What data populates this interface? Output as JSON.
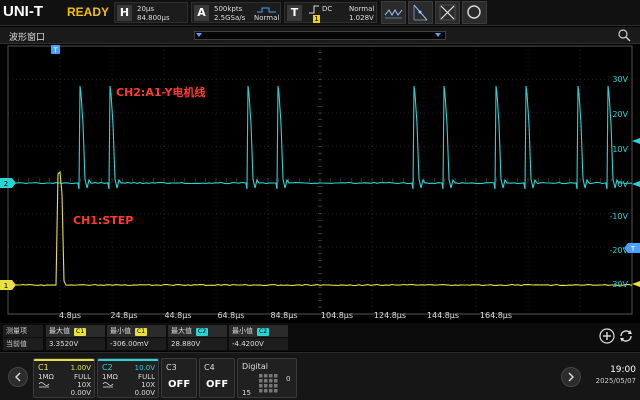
{
  "brand": {
    "logo": "UNI-T",
    "status": "READY"
  },
  "timebase": {
    "letter": "H",
    "scale": "20µs",
    "offset": "84.800µs"
  },
  "acquire": {
    "letter": "A",
    "depth": "500kpts",
    "rate": "2.5GSa/s",
    "mode": "Normal"
  },
  "trigger": {
    "letter": "T",
    "coupling": "DC",
    "source": "1",
    "mode": "Normal",
    "level": "1.028V"
  },
  "toolbar_icons": [
    "wave-measure-icon",
    "cursor-icon",
    "math-icon",
    "search-icon"
  ],
  "window": {
    "title": "波形窗口"
  },
  "waveform": {
    "x_labels": [
      "4.8µs",
      "24.8µs",
      "44.8µs",
      "64.8µs",
      "84.8µs",
      "104.8µs",
      "124.8µs",
      "144.8µs",
      "164.8µs"
    ],
    "y_labels": [
      "30V",
      "20V",
      "10V",
      "0V",
      "-10V",
      "-20V",
      "-30V"
    ],
    "ch1_marker": "1",
    "ch2_marker": "2",
    "trigger_marker": "T",
    "ch1_label": "CH1:STEP",
    "ch2_label": "CH2:A1-Y电机线",
    "colors": {
      "ch1": "#e8e040",
      "ch2": "#2ad4d4",
      "grid": "#3a3a3a",
      "label": "#ff3b30"
    }
  },
  "measure": {
    "header_type": "测量项",
    "header_value": "当前值",
    "items": [
      {
        "name": "最大值",
        "channel": "C1",
        "value": "3.3520V",
        "color": "#e8e040"
      },
      {
        "name": "最小值",
        "channel": "C1",
        "value": "-306.00mV",
        "color": "#e8e040"
      },
      {
        "name": "最大值",
        "channel": "C2",
        "value": "28.880V",
        "color": "#2ad4d4"
      },
      {
        "name": "最小值",
        "channel": "C2",
        "value": "-4.4200V",
        "color": "#2ad4d4"
      }
    ]
  },
  "channels": [
    {
      "name": "C1",
      "scale": "1.00V",
      "impedance": "1MΩ",
      "bandwidth": "FULL",
      "probe": "10X",
      "offset": "0.00V",
      "color": "#e8e040",
      "state": "on"
    },
    {
      "name": "C2",
      "scale": "10.0V",
      "impedance": "1MΩ",
      "bandwidth": "FULL",
      "probe": "10X",
      "offset": "0.00V",
      "color": "#2ad4d4",
      "state": "on"
    },
    {
      "name": "C3",
      "state_label": "OFF"
    },
    {
      "name": "C4",
      "state_label": "OFF"
    }
  ],
  "digital": {
    "title": "Digital",
    "low": "0",
    "high": "15"
  },
  "clock": {
    "time": "19:00",
    "date": "2025/05/07"
  }
}
